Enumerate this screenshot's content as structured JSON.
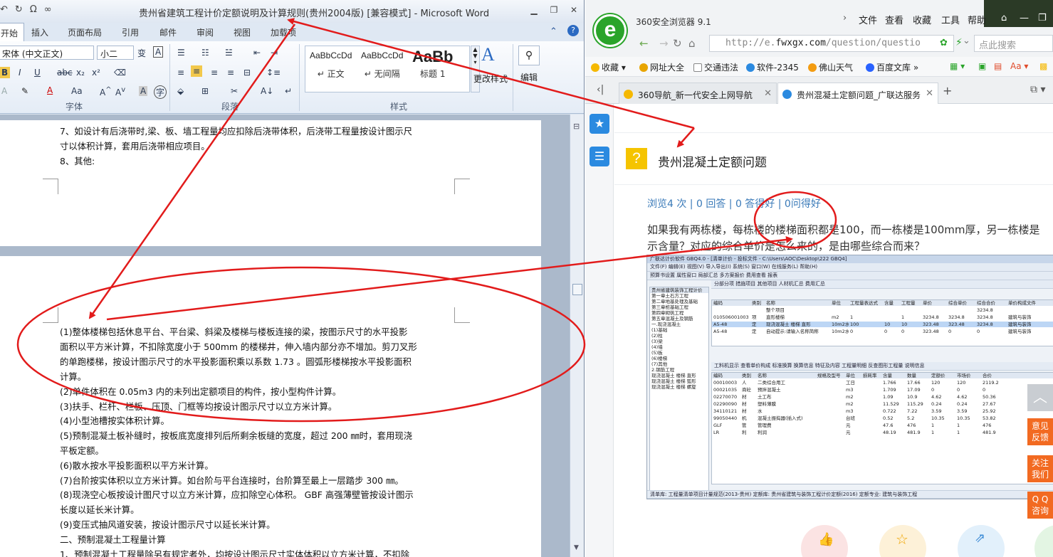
{
  "word": {
    "title": "贵州省建筑工程计价定额说明及计算规则(贵州2004版) [兼容模式] - Microsoft Word",
    "qat": [
      "↶",
      "↻",
      "Ω",
      "∞"
    ],
    "tabs": [
      "开始",
      "插入",
      "页面布局",
      "引用",
      "邮件",
      "审阅",
      "视图",
      "加载项"
    ],
    "ribbon": {
      "font_name": "宋体 (中文正文)",
      "font_size": "小二",
      "group_font": "字体",
      "group_paragraph": "段落",
      "group_styles": "样式",
      "styles": [
        {
          "sample": "AaBbCcDd",
          "name": "↵ 正文"
        },
        {
          "sample": "AaBbCcDd",
          "name": "↵ 无间隔"
        },
        {
          "sample": "AaBb",
          "name": "标题 1"
        }
      ],
      "change_styles": "更改样式",
      "edit": "编辑"
    },
    "page1_lines": [
      "7、如设计有后浇带时,梁、板、墙工程量均应扣除后浇带体积，后浇带工程量按设计图示尺",
      "寸以体积计算，套用后浇带相应项目。",
      "8、其他:"
    ],
    "page2_lines": [
      "(1)整体楼梯包括休息平台、平台梁、斜梁及楼梯与楼板连接的梁，按图示尺寸的水平投影",
      "面积以平方米计算，不扣除宽度小于 500mm 的楼梯井，伸入墙内部分亦不增加。剪刀叉形",
      "的单跑楼梯，按设计图示尺寸的水平投影面积乘以系数 1.73 。圆弧形楼梯按水平投影面积",
      "计算。",
      "(2)单件体积在 0.05m3 内的未列出定额项目的构件，按小型构件计算。",
      "(3)扶手、栏杆、栏板、压顶、门框等均按设计图示尺寸以立方米计算。",
      "(4)小型池槽按实体积计算。",
      "(5)预制混凝土板补缝时，按板底宽度排列后所剩余板缝的宽度，超过 200 ㎜时，套用现浇",
      "平板定额。",
      "(6)散水按水平投影面积以平方米计算。",
      "(7)台阶按实体积以立方米计算。如台阶与平台连接时，台阶算至最上一层踏步 300 ㎜。",
      "(8)现浇空心板按设计图尺寸以立方米计算，应扣除空心体积。  GBF 高强薄壁管按设计图示",
      "长度以延长米计算。",
      "(9)变压式抽风道安装，按设计图示尺寸以延长米计算。",
      "二、预制混凝土工程量计算",
      "1、预制混凝土工程量除另有规定者外，均按设计图示尺寸实体体积以立方米计算，不扣除"
    ]
  },
  "browser": {
    "name": "360安全浏览器 9.1",
    "menu": [
      "文件",
      "查看",
      "收藏",
      "工具",
      "帮助"
    ],
    "url_prefix": "http://e.",
    "url_domain": "fwxgx.com",
    "url_path": "/question/questio",
    "search_placeholder": "点此搜索",
    "bookmarks": [
      "收藏",
      "网址大全",
      "交通违法",
      "软件-2345",
      "佛山天气",
      "百度文库"
    ],
    "tabs": [
      "360导航_新一代安全上网导航",
      "贵州混凝土定额问题_广联达服务"
    ],
    "question": {
      "title": "贵州混凝土定额问题",
      "stats": "浏览4 次 | 0 回答 | 0 答得好 | 0问得好",
      "body_line1": "如果我有两栋楼，每栋楼的楼梯面积都是100，而一栋楼是100mm厚，另一栋楼是",
      "body_line2": "示含量？对应的综合单价是怎么来的，是由哪些综合而来？"
    },
    "float_buttons": [
      "意见\n反馈",
      "关注\n我们",
      "Q Q\n咨询"
    ],
    "top_button": "︿"
  },
  "shot": {
    "title": "广联达计价软件 GBQ4.0 - [清单计价 - 投标文件 - C:\\Users\\AOC\\Desktop\\222 GBQ4]",
    "menu": "文件(F)  编辑(E)  视图(V)  导入导出(I)  系统(S)  窗口(W)  在线服务(L)  帮助(H)",
    "toolbar": "预算书设置  属性窗口  局部汇总  多方案报价  费用查看  报表",
    "tabs": "分部分项  措施项目  其他项目  人材机汇总  费用汇总",
    "left_tree": [
      "贵州省建筑装饰工程计价",
      "第一章土石方工程",
      "第二章地基处理及基础",
      "第三章桩基础工程",
      "第四章砌筑工程",
      "第五章混凝土及钢筋",
      "一.现浇混凝土",
      "(1)基础",
      "(2)柱",
      "(3)梁",
      "(4)墙",
      "(5)板",
      "(6)楼梯",
      "(7)其他",
      "2.钢筋工程",
      "现浇混凝土 楼梯 直形",
      "现浇混凝土 楼梯 弧形",
      "现浇混凝土 楼梯 螺旋"
    ],
    "top_header": [
      "编码",
      "类别",
      "名称",
      "单位",
      "工程量表达式",
      "含量",
      "工程量",
      "单价",
      "综合单价",
      "综合合价",
      "单价构成文件"
    ],
    "top_rows": [
      [
        "",
        "",
        "整个项目",
        "",
        "",
        "",
        "",
        "",
        "",
        "3234.8",
        ""
      ],
      [
        "010506001003",
        "项",
        "直形楼梯",
        "m2",
        "1",
        "",
        "1",
        "3234.8",
        "3234.8",
        "3234.8",
        "建筑与装饰"
      ],
      [
        "A5-48",
        "定",
        "现浇混凝土 楼梯 直形",
        "10m2水",
        "100",
        "10",
        "10",
        "323.48",
        "323.48",
        "3234.8",
        "建筑与装饰"
      ],
      [
        "A5-48",
        "定",
        "自动提示:请输入名称简称",
        "10m2水",
        "0",
        "0",
        "0",
        "323.48",
        "0",
        "0",
        "建筑与装饰"
      ]
    ],
    "bottom_header": [
      "编码",
      "类别",
      "名称",
      "规格及型号",
      "单位",
      "损耗率",
      "含量",
      "数量",
      "定额价",
      "市场价",
      "合价"
    ],
    "bottom_rows": [
      [
        "00010003",
        "人",
        "二类综合用工",
        "",
        "工日",
        "",
        "1.766",
        "17.66",
        "120",
        "120",
        "2119.2"
      ],
      [
        "00021035",
        "商砼",
        "预拌混凝土",
        "",
        "m3",
        "",
        "1.709",
        "17.09",
        "0",
        "0",
        "0"
      ],
      [
        "02270070",
        "材",
        "土工布",
        "",
        "m2",
        "",
        "1.09",
        "10.9",
        "4.62",
        "4.62",
        "50.36"
      ],
      [
        "02290090",
        "材",
        "塑料薄膜",
        "",
        "m2",
        "",
        "11.529",
        "115.29",
        "0.24",
        "0.24",
        "27.67"
      ],
      [
        "34110121",
        "材",
        "水",
        "",
        "m3",
        "",
        "0.722",
        "7.22",
        "3.59",
        "3.59",
        "25.92"
      ],
      [
        "99050440",
        "机",
        "混凝土振捣器(插入式)",
        "",
        "台班",
        "",
        "0.52",
        "5.2",
        "10.35",
        "10.35",
        "53.82"
      ],
      [
        "GLF",
        "管",
        "管理费",
        "",
        "元",
        "",
        "47.6",
        "476",
        "1",
        "1",
        "476"
      ],
      [
        "LR",
        "利",
        "利润",
        "",
        "元",
        "",
        "48.19",
        "481.9",
        "1",
        "1",
        "481.9"
      ]
    ],
    "status": "清单库: 工程量清单项目计量规范(2013-贵州)   定额库: 贵州省建筑与装饰工程计价定额(2016)   定额专业: 建筑与装饰工程"
  },
  "colors": {
    "annotation_red": "#e21b1b",
    "word_blue": "#2b579a",
    "browser_green": "#2aa42a",
    "float_orange": "#f26a21"
  }
}
